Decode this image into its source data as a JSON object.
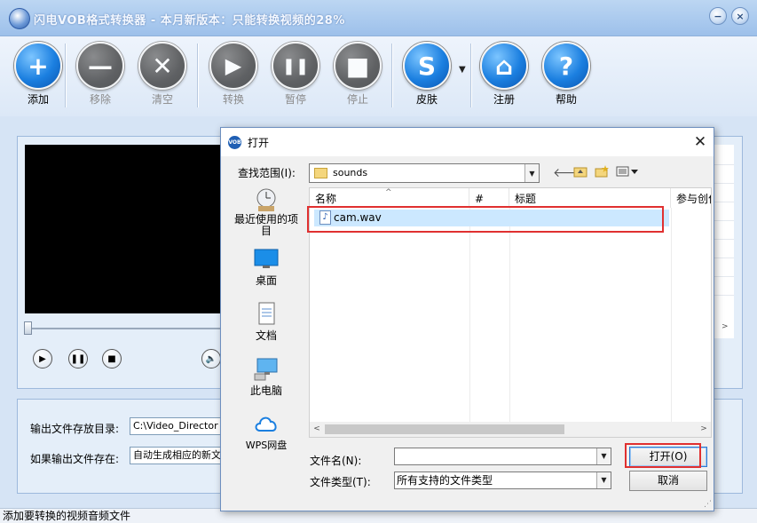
{
  "app": {
    "title": "闪电VOB格式转换器 - 本月新版本：只能转换视频的28%",
    "toolbar": [
      {
        "label": "添加",
        "icon": "plus-icon",
        "glyph": "+",
        "style": "blue",
        "enabled": true
      },
      {
        "label": "移除",
        "icon": "minus-icon",
        "glyph": "—",
        "style": "gray",
        "enabled": false
      },
      {
        "label": "清空",
        "icon": "clear-icon",
        "glyph": "✕",
        "style": "gray",
        "enabled": false
      },
      {
        "label": "转换",
        "icon": "play-icon",
        "glyph": "▶",
        "style": "gray",
        "enabled": false
      },
      {
        "label": "暂停",
        "icon": "pause-icon",
        "glyph": "❚❚",
        "style": "gray",
        "enabled": false
      },
      {
        "label": "停止",
        "icon": "stop-icon",
        "glyph": "■",
        "style": "gray",
        "enabled": false
      },
      {
        "label": "皮肤",
        "icon": "skin-icon",
        "glyph": "S",
        "style": "blue",
        "enabled": true
      },
      {
        "label": "注册",
        "icon": "home-icon",
        "glyph": "⌂",
        "style": "blue",
        "enabled": true
      },
      {
        "label": "帮助",
        "icon": "help-icon",
        "glyph": "?",
        "style": "blue",
        "enabled": true
      }
    ],
    "output": {
      "dir_label": "输出文件存放目录:",
      "dir_value": "C:\\Video_Director",
      "exists_label": "如果输出文件存在:",
      "exists_value": "自动生成相应的新文"
    },
    "status": "添加要转换的视频音频文件"
  },
  "dialog": {
    "title": "打开",
    "lookin_label": "查找范围(I):",
    "lookin_value": "sounds",
    "places": [
      {
        "label": "最近使用的项目",
        "icon": "recent-items-icon"
      },
      {
        "label": "桌面",
        "icon": "desktop-icon"
      },
      {
        "label": "文档",
        "icon": "documents-icon"
      },
      {
        "label": "此电脑",
        "icon": "this-pc-icon"
      },
      {
        "label": "WPS网盘",
        "icon": "wps-cloud-icon"
      }
    ],
    "columns": [
      "名称",
      "#",
      "标题",
      "参与创作"
    ],
    "files": [
      {
        "name": "cam.wav",
        "icon": "audio-file-icon"
      }
    ],
    "filename_label": "文件名(N):",
    "filename_value": "",
    "filetype_label": "文件类型(T):",
    "filetype_value": "所有支持的文件类型",
    "open_label": "打开(O)",
    "cancel_label": "取消"
  },
  "colors": {
    "highlight_box": "#e03030",
    "selection": "#cce8ff",
    "accent": "#1b7fe0"
  }
}
